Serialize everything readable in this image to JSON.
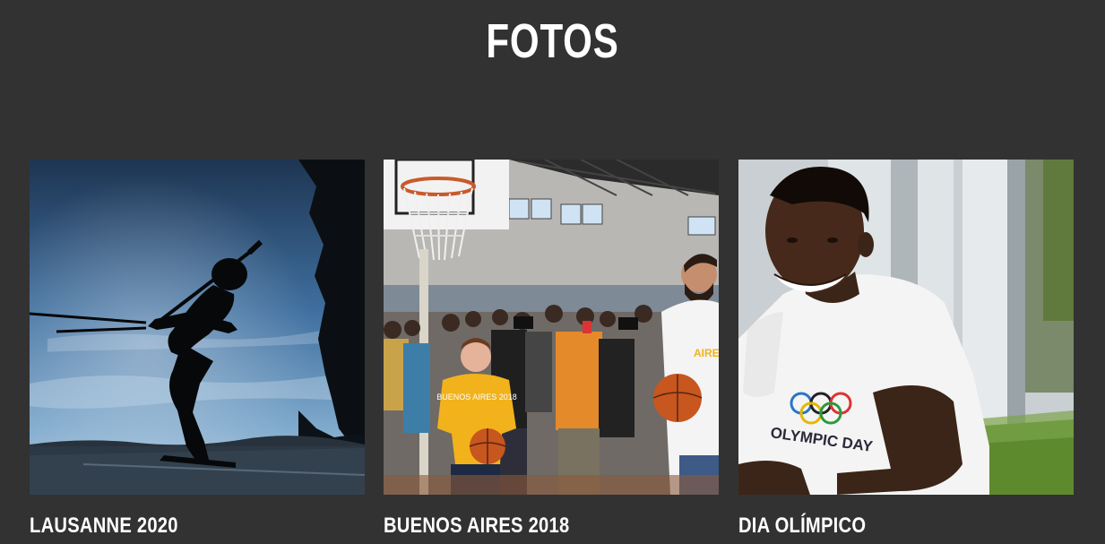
{
  "section": {
    "title": "FOTOS"
  },
  "gallery": {
    "items": [
      {
        "label": "LAUSANNE 2020",
        "image": "biathlon-silhouette-photo"
      },
      {
        "label": "BUENOS AIRES 2018",
        "image": "basketball-gym-crowd-photo",
        "print_logo": "BUENOS AIRES 2018",
        "print_logo_small": "AIRES"
      },
      {
        "label": "DIA OLÍMPICO",
        "image": "smiling-boy-olympic-day-shirt-photo",
        "print_shirt": "OLYMPIC DAY"
      }
    ]
  }
}
